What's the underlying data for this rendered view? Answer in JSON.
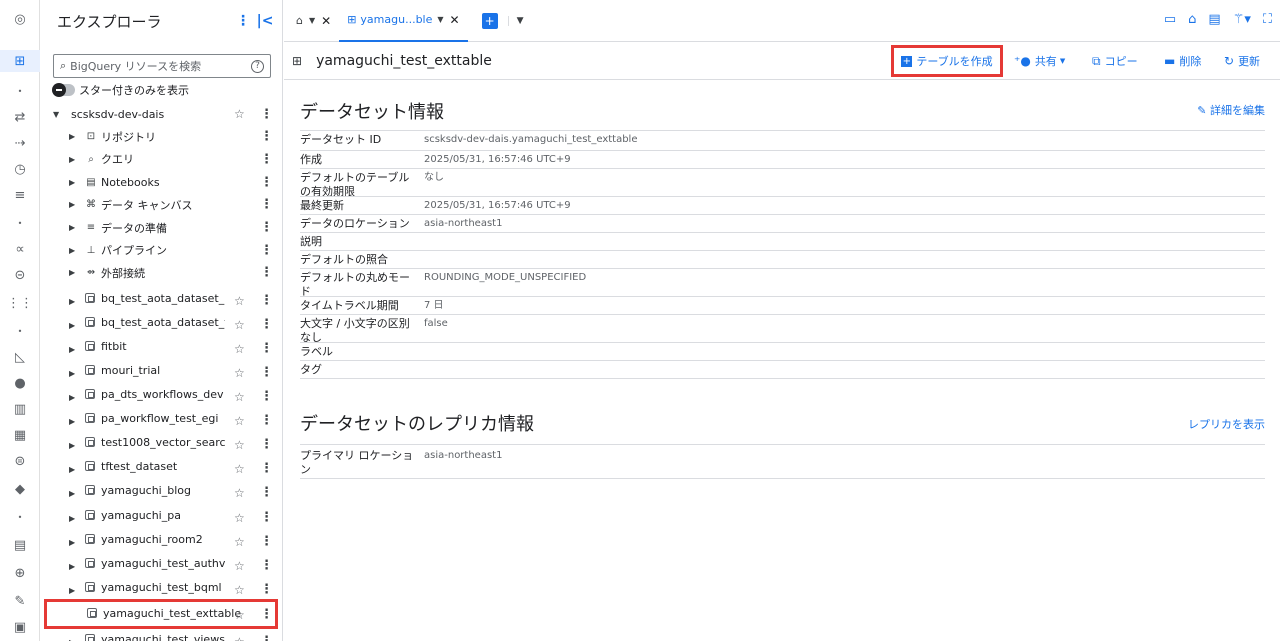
{
  "explorer": {
    "title": "エクスプローラ",
    "search_placeholder": "BigQuery リソースを検索",
    "starred_only_label": "スター付きのみを表示",
    "project": "scsksdv-dev-dais",
    "items": [
      {
        "label": "リポジトリ",
        "icon": "repository-icon",
        "glyph": "⊡"
      },
      {
        "label": "クエリ",
        "icon": "query-icon",
        "glyph": "⌕"
      },
      {
        "label": "Notebooks",
        "icon": "notebook-icon",
        "glyph": "▤"
      },
      {
        "label": "データ キャンバス",
        "icon": "canvas-icon",
        "glyph": "⌘"
      },
      {
        "label": "データの準備",
        "icon": "data-prep-icon",
        "glyph": "≡"
      },
      {
        "label": "パイプライン",
        "icon": "pipeline-icon",
        "glyph": "⊥"
      },
      {
        "label": "外部接続",
        "icon": "connection-icon",
        "glyph": "⇴"
      }
    ],
    "datasets": [
      "bq_test_aota_dataset_...",
      "bq_test_aota_dataset_t...",
      "fitbit",
      "mouri_trial",
      "pa_dts_workflows_dev",
      "pa_workflow_test_egi",
      "test1008_vector_search",
      "tftest_dataset",
      "yamaguchi_blog",
      "yamaguchi_pa",
      "yamaguchi_room2",
      "yamaguchi_test_authvi...",
      "yamaguchi_test_bqml"
    ],
    "selected_table": "yamaguchi_test_exttable",
    "last_dataset": "yamaguchi_test_views"
  },
  "tabs": {
    "active_label": "yamagu...ble"
  },
  "toolbar": {
    "title": "yamaguchi_test_exttable",
    "create_table": "テーブルを作成",
    "share": "共有",
    "copy": "コピー",
    "delete": "削除",
    "refresh": "更新"
  },
  "dataset_info": {
    "title": "データセット情報",
    "edit_details": "詳細を編集",
    "rows": [
      {
        "label": "データセット ID",
        "value": "scsksdv-dev-dais.yamaguchi_test_exttable"
      },
      {
        "label": "作成",
        "value": "2025/05/31, 16:57:46 UTC+9"
      },
      {
        "label": "デフォルトのテーブルの有効期限",
        "value": "なし"
      },
      {
        "label": "最終更新",
        "value": "2025/05/31, 16:57:46 UTC+9"
      },
      {
        "label": "データのロケーション",
        "value": "asia-northeast1"
      },
      {
        "label": "説明",
        "value": ""
      },
      {
        "label": "デフォルトの照合",
        "value": ""
      },
      {
        "label": "デフォルトの丸めモード",
        "value": "ROUNDING_MODE_UNSPECIFIED"
      },
      {
        "label": "タイムトラベル期間",
        "value": "7 日"
      },
      {
        "label": "大文字 / 小文字の区別なし",
        "value": "false"
      },
      {
        "label": "ラベル",
        "value": ""
      },
      {
        "label": "タグ",
        "value": ""
      }
    ]
  },
  "replica_info": {
    "title": "データセットのレプリカ情報",
    "show_replicas": "レプリカを表示",
    "rows": [
      {
        "label": "プライマリ ロケーション",
        "value": "asia-northeast1"
      }
    ]
  }
}
